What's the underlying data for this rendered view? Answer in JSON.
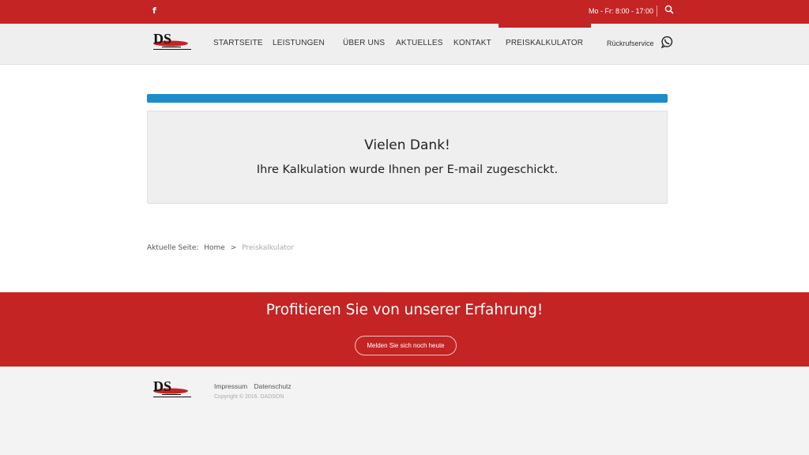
{
  "topbar": {
    "facebook_icon": "facebook-icon",
    "hours": "Mo - Fr: 8:00 - 17:00",
    "search_icon": "search-icon"
  },
  "nav": {
    "logo_text": "DS",
    "logo_subtext": "Maklerbetrieb & Bewertungsmanagement",
    "items": [
      {
        "label": "STARTSEITE"
      },
      {
        "label": "LEISTUNGEN"
      },
      {
        "label": "ÜBER UNS"
      },
      {
        "label": "AKTUELLES"
      },
      {
        "label": "KONTAKT"
      },
      {
        "label": "PREISKALKULATOR",
        "active": true
      }
    ],
    "callback": "Rückrufservice",
    "callback_icon": "whatsapp-icon"
  },
  "main": {
    "progress_percent": 100,
    "title": "Vielen Dank!",
    "text": "Ihre Kalkulation wurde Ihnen per E-mail zugeschickt."
  },
  "breadcrumb": {
    "label": "Aktuelle Seite:",
    "home": "Home",
    "separator": ">",
    "current": "Preiskalkulator"
  },
  "cta": {
    "title": "Profitieren Sie von unserer Erfahrung!",
    "button": "Melden Sie sich noch heute"
  },
  "footer": {
    "links": [
      "Impressum",
      "Datenschutz"
    ],
    "copyright": "Copyright © 2016. DADSON"
  },
  "colors": {
    "brand_red": "#c42424",
    "progress_blue": "#1e8cc9"
  }
}
